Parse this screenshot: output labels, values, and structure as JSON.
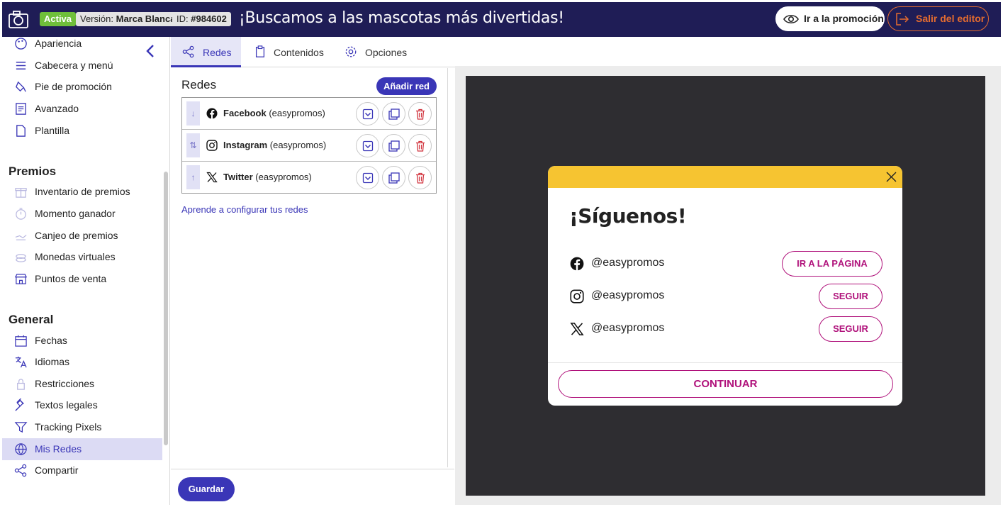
{
  "topbar": {
    "status_badge": "Activa",
    "version_prefix": "Versión:",
    "version_value": "Marca Blanca",
    "id_prefix": "ID:",
    "id_value": "#984602",
    "promo_title": "¡Buscamos a las mascotas más divertidas!",
    "goto_label": "Ir a la promoción",
    "exit_label": "Salir del editor",
    "colors": {
      "bar": "#1f1d56",
      "active": "#6fbf3a",
      "exit": "#e56c2f"
    }
  },
  "sidebar": {
    "items_top": [
      {
        "label": "Apariencia",
        "icon": "palette-icon"
      },
      {
        "label": "Cabecera y menú",
        "icon": "menu-icon"
      },
      {
        "label": "Pie de promoción",
        "icon": "footer-icon"
      },
      {
        "label": "Avanzado",
        "icon": "code-file-icon"
      },
      {
        "label": "Plantilla",
        "icon": "file-icon"
      }
    ],
    "section_premios": "Premios",
    "items_premios": [
      {
        "label": "Inventario de premios",
        "icon": "gift-icon"
      },
      {
        "label": "Momento ganador",
        "icon": "stopwatch-icon"
      },
      {
        "label": "Canjeo de premios",
        "icon": "redeem-icon"
      },
      {
        "label": "Monedas virtuales",
        "icon": "coins-icon"
      },
      {
        "label": "Puntos de venta",
        "icon": "store-icon"
      }
    ],
    "section_general": "General",
    "items_general": [
      {
        "label": "Fechas",
        "icon": "calendar-icon"
      },
      {
        "label": "Idiomas",
        "icon": "translate-icon"
      },
      {
        "label": "Restricciones",
        "icon": "lock-icon"
      },
      {
        "label": "Textos legales",
        "icon": "gavel-icon"
      },
      {
        "label": "Tracking Pixels",
        "icon": "filter-icon"
      },
      {
        "label": "Mis Redes",
        "icon": "globe-icon"
      },
      {
        "label": "Compartir",
        "icon": "share-icon"
      }
    ]
  },
  "tabs": [
    {
      "label": "Redes",
      "icon": "share-icon"
    },
    {
      "label": "Contenidos",
      "icon": "clipboard-icon"
    },
    {
      "label": "Opciones",
      "icon": "gear-icon"
    }
  ],
  "panel": {
    "title": "Redes",
    "add_button": "Añadir red",
    "networks": [
      {
        "name": "Facebook",
        "account": "(easypromos)",
        "handle_arrow": "↓"
      },
      {
        "name": "Instagram",
        "account": "(easypromos)",
        "handle_arrow": "⇅"
      },
      {
        "name": "Twitter",
        "account": "(easypromos)",
        "handle_arrow": "↑"
      }
    ],
    "help_link": "Aprende a configurar tus redes",
    "save_button": "Guardar"
  },
  "preview": {
    "title": "¡Síguenos!",
    "rows": [
      {
        "handle": "@easypromos",
        "button": "IR A LA PÁGINA"
      },
      {
        "handle": "@easypromos",
        "button": "SEGUIR"
      },
      {
        "handle": "@easypromos",
        "button": "SEGUIR"
      }
    ],
    "continue_button": "CONTINUAR",
    "colors": {
      "header": "#f6c431",
      "accent": "#b0127b",
      "backdrop": "#2e2d31"
    }
  }
}
